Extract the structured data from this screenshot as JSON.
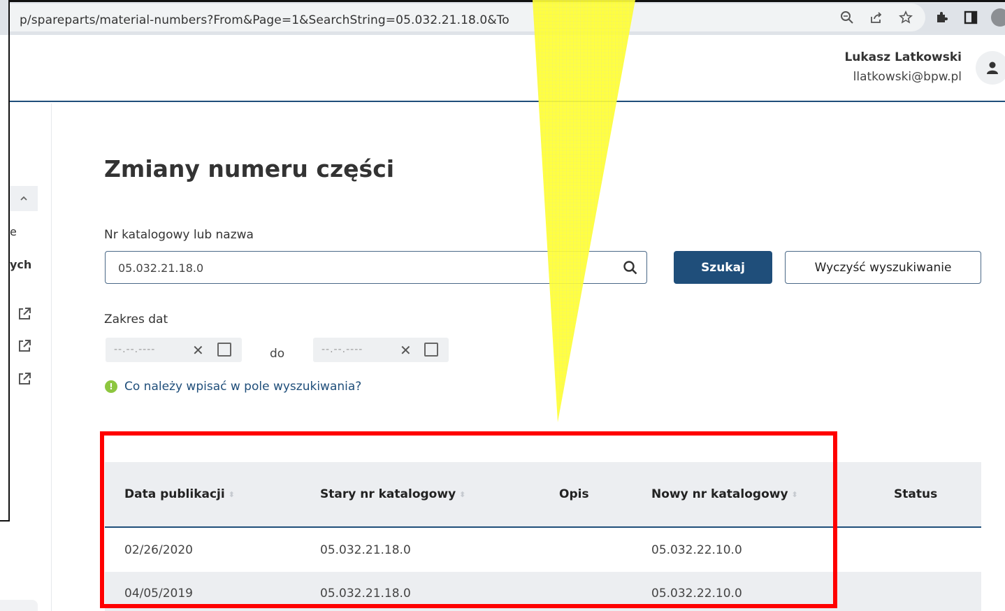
{
  "browser": {
    "url": "p/spareparts/material-numbers?From&Page=1&SearchString=05.032.21.18.0&To",
    "icons": [
      "zoom-icon",
      "share-icon",
      "star-icon",
      "extensions-icon",
      "sidepanel-icon",
      "profile-icon"
    ]
  },
  "header": {
    "user_name": "Lukasz Latkowski",
    "user_email": "llatkowski@bpw.pl"
  },
  "sidebar": {
    "text_e": "e",
    "text_ych": "ych"
  },
  "main": {
    "title": "Zmiany numeru części",
    "search_label": "Nr katalogowy lub nazwa",
    "search_value": "05.032.21.18.0",
    "search_button": "Szukaj",
    "clear_button": "Wyczyść wyszukiwanie",
    "date_label": "Zakres dat",
    "date_from_placeholder": "--.--.----",
    "date_to_placeholder": "--.--.----",
    "date_separator": "do",
    "help_link": "Co należy wpisać w pole wyszukiwania?"
  },
  "table": {
    "columns": [
      "Data publikacji",
      "Stary nr katalogowy",
      "Opis",
      "Nowy nr katalogowy",
      "Status"
    ],
    "rows": [
      {
        "date": "02/26/2020",
        "old": "05.032.21.18.0",
        "desc": "",
        "new": "05.032.22.10.0",
        "status": ""
      },
      {
        "date": "04/05/2019",
        "old": "05.032.21.18.0",
        "desc": "",
        "new": "05.032.22.10.0",
        "status": ""
      }
    ]
  },
  "colors": {
    "primary": "#1f4e7a",
    "annotation_red": "#ff0000",
    "annotation_yellow": "#ffff33",
    "info_green": "#8dc63f"
  }
}
